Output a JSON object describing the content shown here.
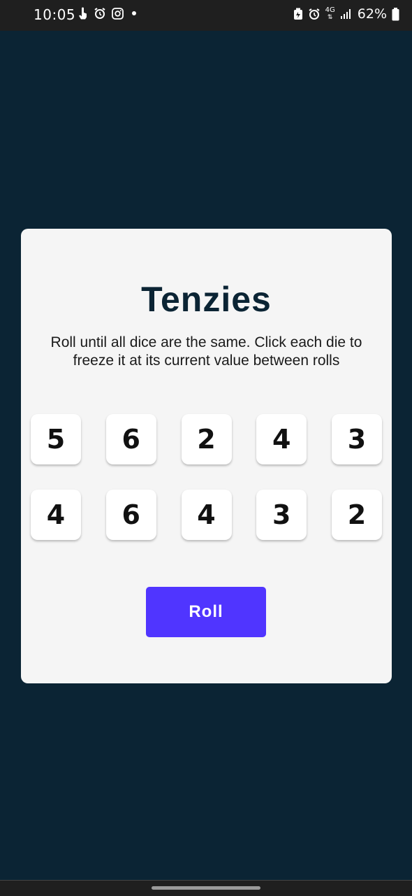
{
  "status_bar": {
    "time": "10:05",
    "left_icons": [
      "touch-icon",
      "alarm-icon",
      "instagram-icon",
      "dot-icon"
    ],
    "network": "4G",
    "battery_percent": "62%"
  },
  "app": {
    "title": "Tenzies",
    "instructions": "Roll until all dice are the same. Click each die to freeze it at its current value between rolls",
    "dice": [
      "5",
      "6",
      "2",
      "4",
      "3",
      "4",
      "6",
      "4",
      "3",
      "2"
    ],
    "roll_label": "Roll"
  },
  "colors": {
    "background": "#0b2434",
    "card": "#f5f5f5",
    "title": "#0b2434",
    "button": "#5035ff",
    "die": "#ffffff"
  }
}
